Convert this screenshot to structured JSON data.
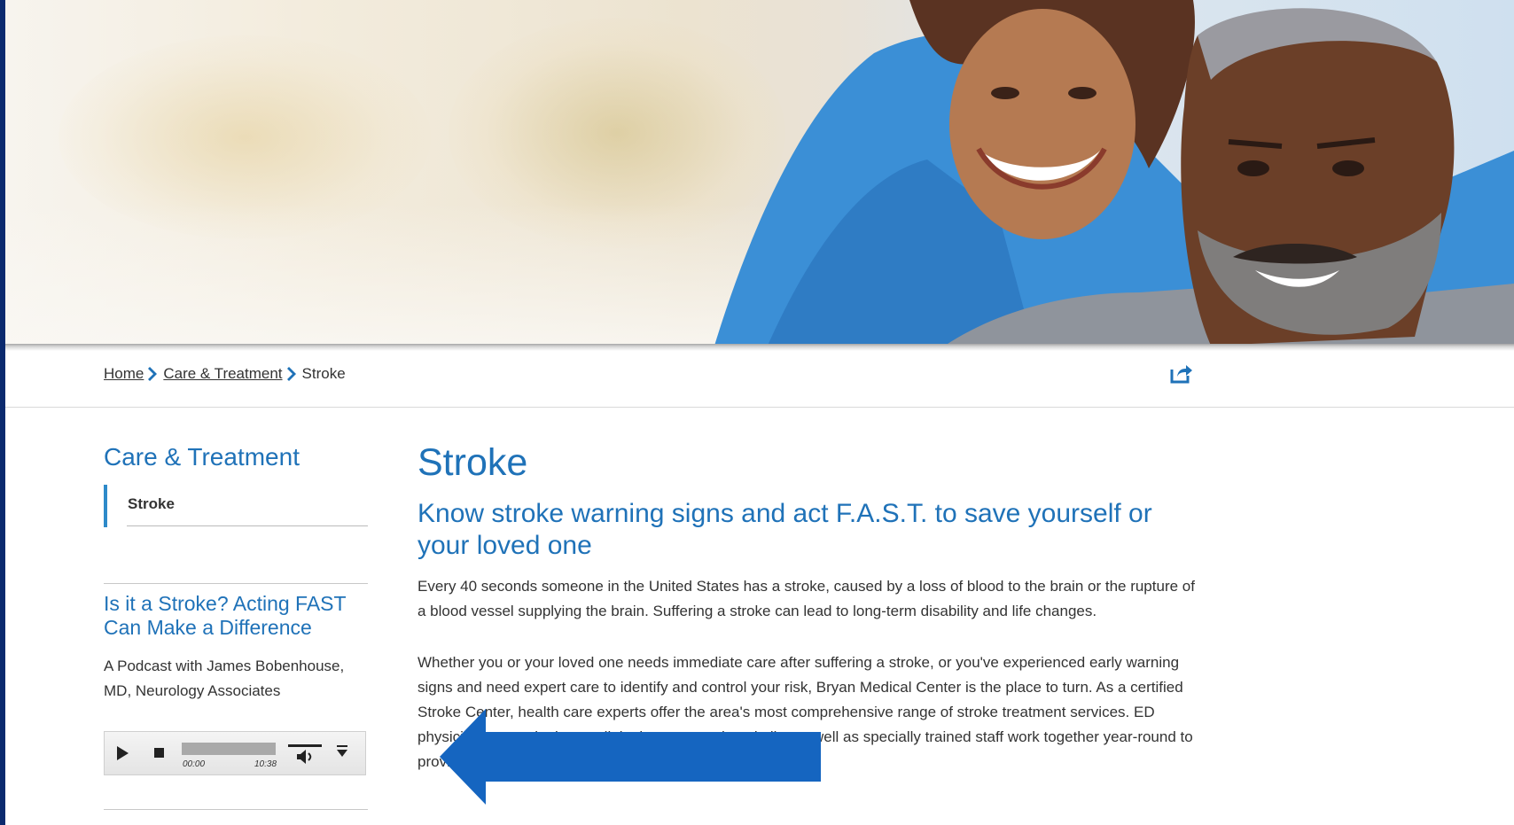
{
  "hero": {
    "image_description_icon": "couple-photo"
  },
  "breadcrumb": {
    "items": [
      {
        "label": "Home",
        "link": true
      },
      {
        "label": "Care & Treatment",
        "link": true
      },
      {
        "label": "Stroke",
        "link": false
      }
    ],
    "share_icon": "share-icon"
  },
  "sidebar": {
    "title": "Care & Treatment",
    "items": [
      {
        "label": "Stroke",
        "active": true
      }
    ],
    "podcast": {
      "title": "Is it a Stroke? Acting FAST Can Make a Difference",
      "description": "A Podcast with James Bobenhouse, MD, Neurology Associates",
      "player": {
        "current_time": "00:00",
        "duration": "10:38",
        "progress": 0
      }
    }
  },
  "main": {
    "title": "Stroke",
    "subtitle": "Know stroke warning signs and act F.A.S.T. to save yourself or your loved one",
    "paragraphs": [
      "Every 40 seconds someone in the United States has a stroke, caused by a loss of blood to the brain or the rupture of a blood vessel supplying the brain. Suffering a stroke can lead to long-term disability and life changes.",
      "Whether you or your loved one needs immediate care after suffering a stroke, or you've experienced early warning signs and need expert care to identify and control your risk, Bryan Medical Center is the place to turn. As a certified Stroke Center, health care experts offer the area's most comprehensive range of stroke treatment services. ED physicians, neurologists, radiologists, a neurohospitalist as well as specially trained staff work together year-round to provide you or your loved one with the most advanced care."
    ]
  },
  "colors": {
    "accent": "#1f72b8",
    "frame": "#0b2a6e",
    "arrow": "#1565c0"
  }
}
